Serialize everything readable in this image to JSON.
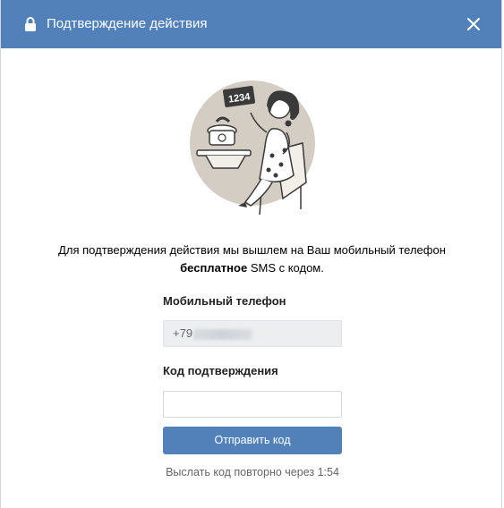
{
  "dialog": {
    "title": "Подтверждение действия",
    "lock_icon": "lock-icon",
    "close_icon": "close-icon"
  },
  "illustration": {
    "code_sign_text": "1234"
  },
  "description": {
    "line1": "Для подтверждения действия мы вышлем на Ваш мобильный телефон",
    "bold": "бесплатное",
    "rest": " SMS с кодом."
  },
  "phone": {
    "label": "Мобильный телефон",
    "value_visible": "+79"
  },
  "code": {
    "label": "Код подтверждения",
    "value": ""
  },
  "send_button": "Отправить код",
  "resend_text": "Выслать код повторно через 1:54",
  "colors": {
    "header": "#5181b8",
    "button": "#5181b8",
    "illustration_bg": "#d4cdc4"
  }
}
